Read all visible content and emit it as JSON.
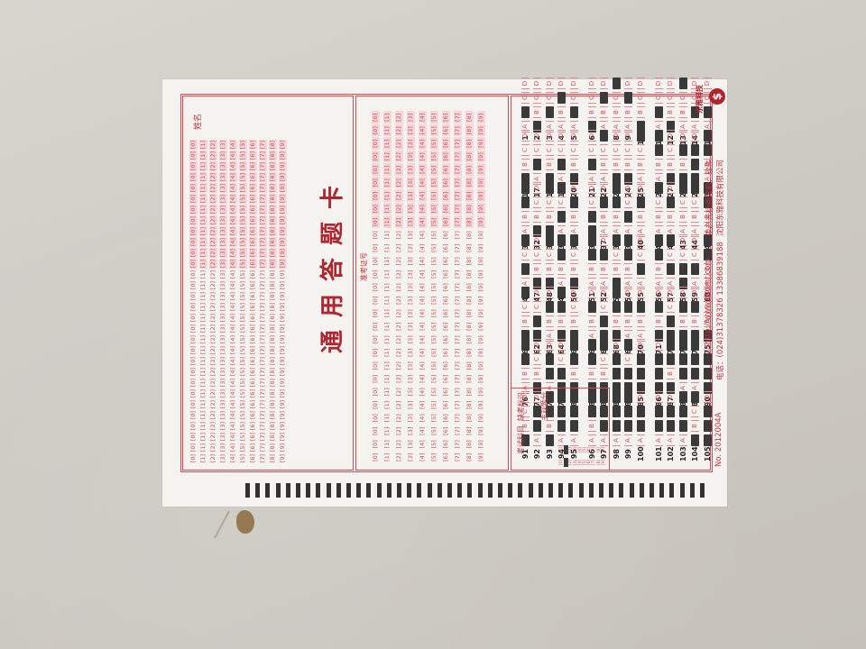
{
  "title": "通用答题卡",
  "name_label": "姓名",
  "exam_id_label": "准考证号",
  "absent_label": "缺考标识",
  "subjective_label": "主观题分",
  "subject_label": "考试科目",
  "company": "沈阳东雅科技有限公司",
  "phone": "电话：(024)31378326  13386839188",
  "products": "生产光标阅读机、软件",
  "website": "http://www.dsomr.com",
  "serial": "No. 2012004A",
  "brand": "东雅科技",
  "logo_char": "$",
  "option_letters": [
    "A",
    "B",
    "C",
    "D"
  ],
  "digits": [
    "0",
    "1",
    "2",
    "3",
    "4",
    "5",
    "6",
    "7",
    "8",
    "9"
  ],
  "questions": [
    {
      "n": "1",
      "fill": [
        1
      ]
    },
    {
      "n": "2",
      "fill": [
        0
      ]
    },
    {
      "n": "3",
      "fill": [
        1
      ]
    },
    {
      "n": "4",
      "fill": [
        2
      ]
    },
    {
      "n": "5",
      "fill": [
        1
      ]
    },
    {
      "n": "6",
      "fill": [
        0
      ]
    },
    {
      "n": "7",
      "fill": [
        2
      ]
    },
    {
      "n": "8",
      "fill": [
        3
      ]
    },
    {
      "n": "9",
      "fill": [
        2
      ]
    },
    {
      "n": "10",
      "fill": [
        0
      ]
    },
    {
      "n": "11",
      "fill": [
        1
      ]
    },
    {
      "n": "12",
      "fill": [
        0
      ]
    },
    {
      "n": "13",
      "fill": [
        3
      ]
    },
    {
      "n": "14",
      "fill": [
        1
      ]
    },
    {
      "n": "15",
      "fill": [
        1
      ]
    },
    {
      "n": "16",
      "fill": [
        0
      ]
    },
    {
      "n": "17",
      "fill": [
        1
      ]
    },
    {
      "n": "18",
      "fill": [
        0
      ]
    },
    {
      "n": "19",
      "fill": [
        1
      ]
    },
    {
      "n": "20",
      "fill": [
        0
      ]
    },
    {
      "n": "21",
      "fill": [
        1
      ]
    },
    {
      "n": "22",
      "fill": [
        3
      ]
    },
    {
      "n": "23",
      "fill": [
        0
      ]
    },
    {
      "n": "24",
      "fill": [
        0
      ]
    },
    {
      "n": "25",
      "fill": [
        3
      ]
    },
    {
      "n": "26",
      "fill": [
        2,
        3
      ]
    },
    {
      "n": "27",
      "fill": [
        0
      ]
    },
    {
      "n": "28",
      "fill": [
        0,
        2
      ]
    },
    {
      "n": "29",
      "fill": [
        0,
        1,
        2
      ]
    },
    {
      "n": "30",
      "fill": [
        2,
        3
      ]
    },
    {
      "n": "31",
      "fill": [
        2,
        3
      ]
    },
    {
      "n": "32",
      "fill": [
        0
      ]
    },
    {
      "n": "33",
      "fill": [
        0,
        3
      ]
    },
    {
      "n": "34",
      "fill": [
        1,
        3
      ]
    },
    {
      "n": "35",
      "fill": [
        2
      ]
    },
    {
      "n": "36",
      "fill": [
        0,
        1
      ]
    },
    {
      "n": "37",
      "fill": [
        2
      ]
    },
    {
      "n": "38",
      "fill": [
        2,
        3
      ]
    },
    {
      "n": "39",
      "fill": [
        1
      ]
    },
    {
      "n": "40",
      "fill": [
        2
      ]
    },
    {
      "n": "41",
      "fill": [
        3
      ]
    },
    {
      "n": "42",
      "fill": [
        2
      ]
    },
    {
      "n": "43",
      "fill": [
        3
      ]
    },
    {
      "n": "44",
      "fill": [
        3
      ]
    },
    {
      "n": "45",
      "fill": [
        2,
        3
      ]
    },
    {
      "n": "46",
      "fill": [
        1,
        3
      ]
    },
    {
      "n": "47",
      "fill": [
        0
      ]
    },
    {
      "n": "48",
      "fill": [
        0,
        3
      ]
    },
    {
      "n": "49",
      "fill": [
        2,
        3
      ]
    },
    {
      "n": "50",
      "fill": [
        0,
        3
      ]
    },
    {
      "n": "51",
      "fill": [
        2,
        3
      ]
    },
    {
      "n": "52",
      "fill": [
        2
      ]
    },
    {
      "n": "53",
      "fill": [
        0,
        3
      ]
    },
    {
      "n": "54",
      "fill": [
        2,
        3
      ]
    },
    {
      "n": "55",
      "fill": [
        1
      ]
    },
    {
      "n": "56",
      "fill": [
        2,
        3
      ]
    },
    {
      "n": "57",
      "fill": [
        1,
        3
      ]
    },
    {
      "n": "58",
      "fill": [
        0,
        1
      ]
    },
    {
      "n": "59",
      "fill": [
        1
      ]
    },
    {
      "n": "60",
      "fill": [
        2,
        3
      ]
    },
    {
      "n": "61",
      "fill": [
        0,
        3
      ]
    },
    {
      "n": "62",
      "fill": [
        0,
        1
      ]
    },
    {
      "n": "63",
      "fill": [
        2
      ]
    },
    {
      "n": "64",
      "fill": [
        0,
        2,
        3
      ]
    },
    {
      "n": "65",
      "fill": [
        0
      ]
    },
    {
      "n": "66",
      "fill": [
        2
      ]
    },
    {
      "n": "67",
      "fill": [
        0,
        1
      ]
    },
    {
      "n": "68",
      "fill": [
        0,
        2,
        3
      ]
    },
    {
      "n": "69",
      "fill": [
        2
      ]
    },
    {
      "n": "70",
      "fill": [
        2
      ]
    },
    {
      "n": "71",
      "fill": [
        0,
        2
      ]
    },
    {
      "n": "72",
      "fill": [
        0,
        1
      ]
    },
    {
      "n": "73",
      "fill": [
        0,
        2
      ]
    },
    {
      "n": "74",
      "fill": [
        0,
        2
      ]
    },
    {
      "n": "75",
      "fill": [
        0
      ]
    },
    {
      "n": "76",
      "fill": [
        2,
        3
      ]
    },
    {
      "n": "77",
      "fill": [
        0
      ]
    },
    {
      "n": "78",
      "fill": [
        1,
        2
      ]
    },
    {
      "n": "79",
      "fill": [
        0,
        1
      ]
    },
    {
      "n": "80",
      "fill": [
        0,
        2,
        3
      ]
    },
    {
      "n": "81",
      "fill": [
        0,
        2,
        3
      ]
    },
    {
      "n": "82",
      "fill": [
        0,
        3
      ]
    },
    {
      "n": "83",
      "fill": [
        0,
        1,
        2
      ]
    },
    {
      "n": "84",
      "fill": [
        0,
        1,
        3
      ]
    },
    {
      "n": "85",
      "fill": [
        0,
        1,
        2
      ]
    },
    {
      "n": "86",
      "fill": [
        0,
        1,
        2
      ]
    },
    {
      "n": "87",
      "fill": [
        0,
        2,
        3
      ]
    },
    {
      "n": "88",
      "fill": [
        1,
        2,
        3
      ]
    },
    {
      "n": "89",
      "fill": [
        1,
        2,
        3
      ]
    },
    {
      "n": "90",
      "fill": [
        0,
        1,
        2
      ]
    },
    {
      "n": "91",
      "fill": [
        0
      ]
    },
    {
      "n": "92",
      "fill": [
        1,
        2
      ]
    },
    {
      "n": "93",
      "fill": [
        0,
        2,
        3
      ]
    },
    {
      "n": "94",
      "fill": [
        1,
        2,
        3
      ]
    },
    {
      "n": "95",
      "fill": [
        1,
        2,
        3
      ]
    },
    {
      "n": "96",
      "fill": [
        2,
        3
      ]
    },
    {
      "n": "97",
      "fill": [
        1,
        2,
        3
      ]
    },
    {
      "n": "98",
      "fill": [
        1,
        2,
        3
      ]
    },
    {
      "n": "99",
      "fill": [
        1,
        2,
        3
      ]
    },
    {
      "n": "100",
      "fill": [
        1,
        2
      ]
    },
    {
      "n": "101",
      "fill": [
        1,
        2
      ]
    },
    {
      "n": "102",
      "fill": [
        1,
        2
      ]
    },
    {
      "n": "103",
      "fill": [
        1,
        2,
        3
      ]
    },
    {
      "n": "104",
      "fill": [
        0,
        3
      ]
    },
    {
      "n": "105",
      "fill": [
        0,
        1,
        2
      ]
    }
  ],
  "scores": [
    {
      "fill": 1
    },
    {
      "fill": 1
    }
  ]
}
